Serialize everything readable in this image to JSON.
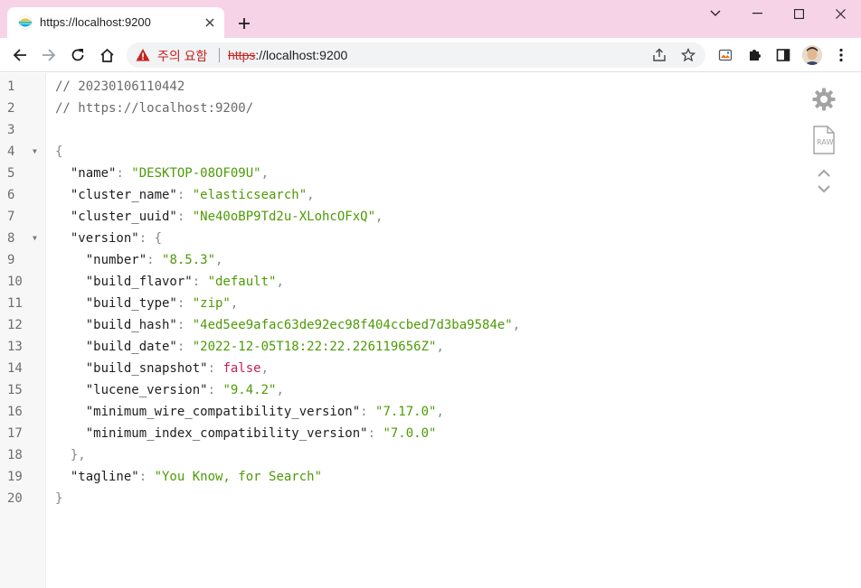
{
  "tab": {
    "title": "https://localhost:9200",
    "close_label": "×"
  },
  "new_tab_label": "+",
  "window": {
    "minimize": "minimize",
    "maximize": "maximize",
    "close": "close"
  },
  "omnibox": {
    "warning_text": "주의 요함",
    "url_scheme": "https",
    "url_rest": "://localhost:9200"
  },
  "colors": {
    "tabstrip": "#f6d3e6",
    "string": "#4e9a06",
    "boolean": "#c21f5a",
    "warning": "#c5221f"
  },
  "viewer": {
    "side_tools": [
      "gear-icon",
      "raw-icon",
      "chevron-up-icon",
      "chevron-down-icon"
    ],
    "raw_label": "RAW",
    "lines": [
      {
        "n": "1",
        "fold": "",
        "segments": [
          [
            "c",
            "// 20230106110442"
          ]
        ]
      },
      {
        "n": "2",
        "fold": "",
        "segments": [
          [
            "c",
            "// https://localhost:9200/"
          ]
        ]
      },
      {
        "n": "3",
        "fold": "",
        "segments": []
      },
      {
        "n": "4",
        "fold": "▼",
        "segments": [
          [
            "p",
            "{"
          ]
        ]
      },
      {
        "n": "5",
        "fold": "",
        "segments": [
          [
            "k",
            "  \"name\""
          ],
          [
            "p",
            ": "
          ],
          [
            "s",
            "\"DESKTOP-08OF09U\""
          ],
          [
            "p",
            ","
          ]
        ]
      },
      {
        "n": "6",
        "fold": "",
        "segments": [
          [
            "k",
            "  \"cluster_name\""
          ],
          [
            "p",
            ": "
          ],
          [
            "s",
            "\"elasticsearch\""
          ],
          [
            "p",
            ","
          ]
        ]
      },
      {
        "n": "7",
        "fold": "",
        "segments": [
          [
            "k",
            "  \"cluster_uuid\""
          ],
          [
            "p",
            ": "
          ],
          [
            "s",
            "\"Ne40oBP9Td2u-XLohcOFxQ\""
          ],
          [
            "p",
            ","
          ]
        ]
      },
      {
        "n": "8",
        "fold": "▼",
        "segments": [
          [
            "k",
            "  \"version\""
          ],
          [
            "p",
            ": {"
          ]
        ]
      },
      {
        "n": "9",
        "fold": "",
        "segments": [
          [
            "k",
            "    \"number\""
          ],
          [
            "p",
            ": "
          ],
          [
            "s",
            "\"8.5.3\""
          ],
          [
            "p",
            ","
          ]
        ]
      },
      {
        "n": "10",
        "fold": "",
        "segments": [
          [
            "k",
            "    \"build_flavor\""
          ],
          [
            "p",
            ": "
          ],
          [
            "s",
            "\"default\""
          ],
          [
            "p",
            ","
          ]
        ]
      },
      {
        "n": "11",
        "fold": "",
        "segments": [
          [
            "k",
            "    \"build_type\""
          ],
          [
            "p",
            ": "
          ],
          [
            "s",
            "\"zip\""
          ],
          [
            "p",
            ","
          ]
        ]
      },
      {
        "n": "12",
        "fold": "",
        "segments": [
          [
            "k",
            "    \"build_hash\""
          ],
          [
            "p",
            ": "
          ],
          [
            "s",
            "\"4ed5ee9afac63de92ec98f404ccbed7d3ba9584e\""
          ],
          [
            "p",
            ","
          ]
        ]
      },
      {
        "n": "13",
        "fold": "",
        "segments": [
          [
            "k",
            "    \"build_date\""
          ],
          [
            "p",
            ": "
          ],
          [
            "s",
            "\"2022-12-05T18:22:22.226119656Z\""
          ],
          [
            "p",
            ","
          ]
        ]
      },
      {
        "n": "14",
        "fold": "",
        "segments": [
          [
            "k",
            "    \"build_snapshot\""
          ],
          [
            "p",
            ": "
          ],
          [
            "b",
            "false"
          ],
          [
            "p",
            ","
          ]
        ]
      },
      {
        "n": "15",
        "fold": "",
        "segments": [
          [
            "k",
            "    \"lucene_version\""
          ],
          [
            "p",
            ": "
          ],
          [
            "s",
            "\"9.4.2\""
          ],
          [
            "p",
            ","
          ]
        ]
      },
      {
        "n": "16",
        "fold": "",
        "segments": [
          [
            "k",
            "    \"minimum_wire_compatibility_version\""
          ],
          [
            "p",
            ": "
          ],
          [
            "s",
            "\"7.17.0\""
          ],
          [
            "p",
            ","
          ]
        ]
      },
      {
        "n": "17",
        "fold": "",
        "segments": [
          [
            "k",
            "    \"minimum_index_compatibility_version\""
          ],
          [
            "p",
            ": "
          ],
          [
            "s",
            "\"7.0.0\""
          ]
        ]
      },
      {
        "n": "18",
        "fold": "",
        "segments": [
          [
            "p",
            "  },"
          ]
        ]
      },
      {
        "n": "19",
        "fold": "",
        "segments": [
          [
            "k",
            "  \"tagline\""
          ],
          [
            "p",
            ": "
          ],
          [
            "s",
            "\"You Know, for Search\""
          ]
        ]
      },
      {
        "n": "20",
        "fold": "",
        "segments": [
          [
            "p",
            "}"
          ]
        ]
      }
    ]
  }
}
